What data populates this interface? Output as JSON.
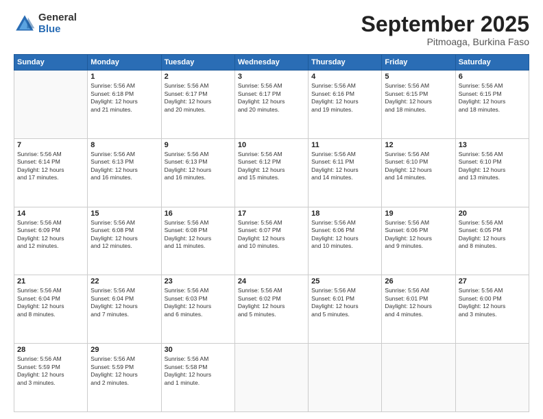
{
  "header": {
    "logo_general": "General",
    "logo_blue": "Blue",
    "month": "September 2025",
    "location": "Pitmoaga, Burkina Faso"
  },
  "weekdays": [
    "Sunday",
    "Monday",
    "Tuesday",
    "Wednesday",
    "Thursday",
    "Friday",
    "Saturday"
  ],
  "weeks": [
    [
      {
        "day": "",
        "info": ""
      },
      {
        "day": "1",
        "info": "Sunrise: 5:56 AM\nSunset: 6:18 PM\nDaylight: 12 hours\nand 21 minutes."
      },
      {
        "day": "2",
        "info": "Sunrise: 5:56 AM\nSunset: 6:17 PM\nDaylight: 12 hours\nand 20 minutes."
      },
      {
        "day": "3",
        "info": "Sunrise: 5:56 AM\nSunset: 6:17 PM\nDaylight: 12 hours\nand 20 minutes."
      },
      {
        "day": "4",
        "info": "Sunrise: 5:56 AM\nSunset: 6:16 PM\nDaylight: 12 hours\nand 19 minutes."
      },
      {
        "day": "5",
        "info": "Sunrise: 5:56 AM\nSunset: 6:15 PM\nDaylight: 12 hours\nand 18 minutes."
      },
      {
        "day": "6",
        "info": "Sunrise: 5:56 AM\nSunset: 6:15 PM\nDaylight: 12 hours\nand 18 minutes."
      }
    ],
    [
      {
        "day": "7",
        "info": "Sunrise: 5:56 AM\nSunset: 6:14 PM\nDaylight: 12 hours\nand 17 minutes."
      },
      {
        "day": "8",
        "info": "Sunrise: 5:56 AM\nSunset: 6:13 PM\nDaylight: 12 hours\nand 16 minutes."
      },
      {
        "day": "9",
        "info": "Sunrise: 5:56 AM\nSunset: 6:13 PM\nDaylight: 12 hours\nand 16 minutes."
      },
      {
        "day": "10",
        "info": "Sunrise: 5:56 AM\nSunset: 6:12 PM\nDaylight: 12 hours\nand 15 minutes."
      },
      {
        "day": "11",
        "info": "Sunrise: 5:56 AM\nSunset: 6:11 PM\nDaylight: 12 hours\nand 14 minutes."
      },
      {
        "day": "12",
        "info": "Sunrise: 5:56 AM\nSunset: 6:10 PM\nDaylight: 12 hours\nand 14 minutes."
      },
      {
        "day": "13",
        "info": "Sunrise: 5:56 AM\nSunset: 6:10 PM\nDaylight: 12 hours\nand 13 minutes."
      }
    ],
    [
      {
        "day": "14",
        "info": "Sunrise: 5:56 AM\nSunset: 6:09 PM\nDaylight: 12 hours\nand 12 minutes."
      },
      {
        "day": "15",
        "info": "Sunrise: 5:56 AM\nSunset: 6:08 PM\nDaylight: 12 hours\nand 12 minutes."
      },
      {
        "day": "16",
        "info": "Sunrise: 5:56 AM\nSunset: 6:08 PM\nDaylight: 12 hours\nand 11 minutes."
      },
      {
        "day": "17",
        "info": "Sunrise: 5:56 AM\nSunset: 6:07 PM\nDaylight: 12 hours\nand 10 minutes."
      },
      {
        "day": "18",
        "info": "Sunrise: 5:56 AM\nSunset: 6:06 PM\nDaylight: 12 hours\nand 10 minutes."
      },
      {
        "day": "19",
        "info": "Sunrise: 5:56 AM\nSunset: 6:06 PM\nDaylight: 12 hours\nand 9 minutes."
      },
      {
        "day": "20",
        "info": "Sunrise: 5:56 AM\nSunset: 6:05 PM\nDaylight: 12 hours\nand 8 minutes."
      }
    ],
    [
      {
        "day": "21",
        "info": "Sunrise: 5:56 AM\nSunset: 6:04 PM\nDaylight: 12 hours\nand 8 minutes."
      },
      {
        "day": "22",
        "info": "Sunrise: 5:56 AM\nSunset: 6:04 PM\nDaylight: 12 hours\nand 7 minutes."
      },
      {
        "day": "23",
        "info": "Sunrise: 5:56 AM\nSunset: 6:03 PM\nDaylight: 12 hours\nand 6 minutes."
      },
      {
        "day": "24",
        "info": "Sunrise: 5:56 AM\nSunset: 6:02 PM\nDaylight: 12 hours\nand 5 minutes."
      },
      {
        "day": "25",
        "info": "Sunrise: 5:56 AM\nSunset: 6:01 PM\nDaylight: 12 hours\nand 5 minutes."
      },
      {
        "day": "26",
        "info": "Sunrise: 5:56 AM\nSunset: 6:01 PM\nDaylight: 12 hours\nand 4 minutes."
      },
      {
        "day": "27",
        "info": "Sunrise: 5:56 AM\nSunset: 6:00 PM\nDaylight: 12 hours\nand 3 minutes."
      }
    ],
    [
      {
        "day": "28",
        "info": "Sunrise: 5:56 AM\nSunset: 5:59 PM\nDaylight: 12 hours\nand 3 minutes."
      },
      {
        "day": "29",
        "info": "Sunrise: 5:56 AM\nSunset: 5:59 PM\nDaylight: 12 hours\nand 2 minutes."
      },
      {
        "day": "30",
        "info": "Sunrise: 5:56 AM\nSunset: 5:58 PM\nDaylight: 12 hours\nand 1 minute."
      },
      {
        "day": "",
        "info": ""
      },
      {
        "day": "",
        "info": ""
      },
      {
        "day": "",
        "info": ""
      },
      {
        "day": "",
        "info": ""
      }
    ]
  ]
}
